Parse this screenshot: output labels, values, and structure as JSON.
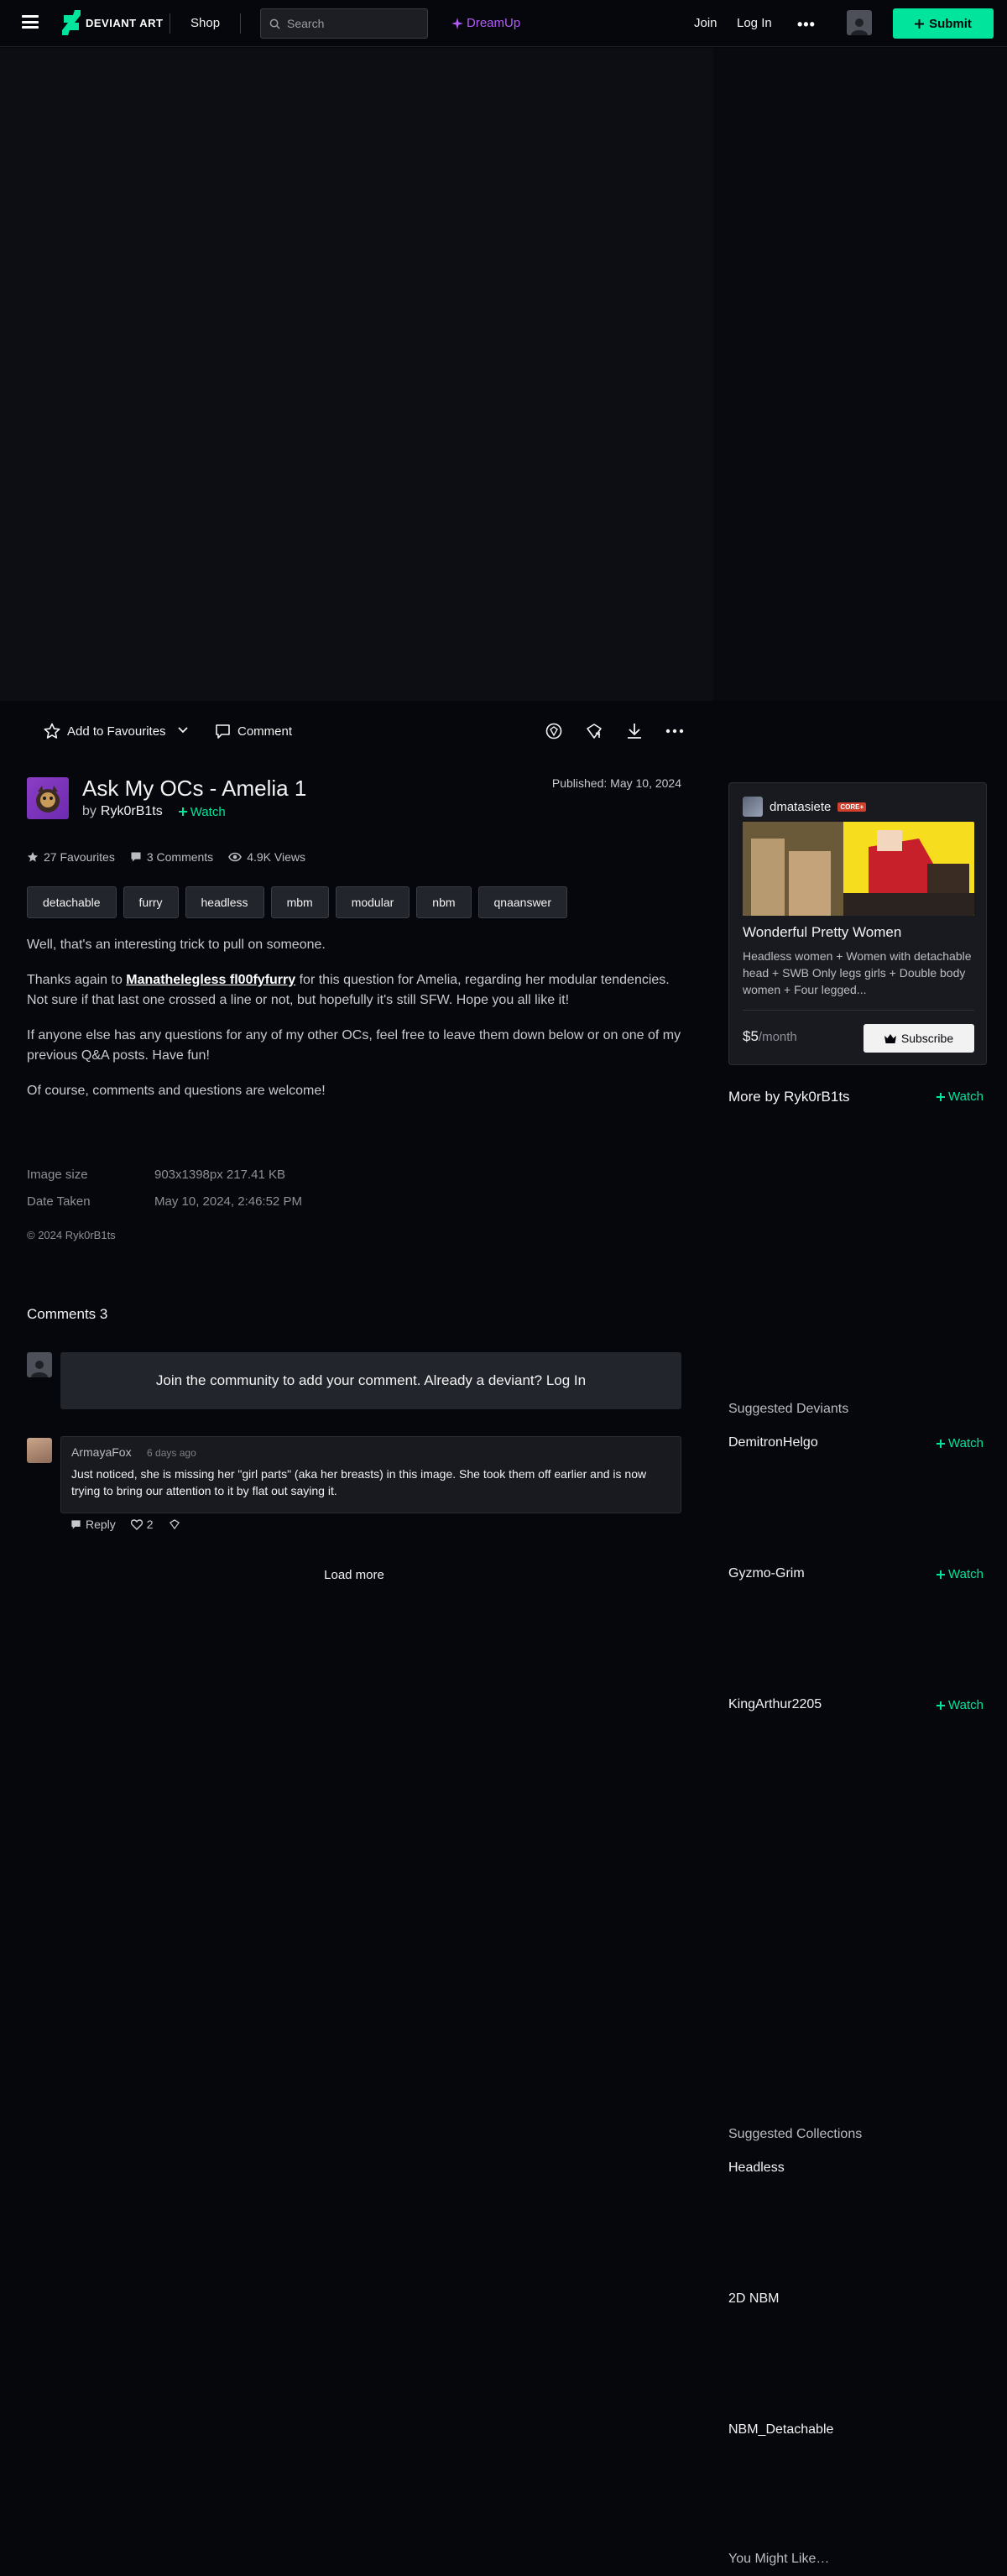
{
  "header": {
    "logo_text": "DEVIANT ART",
    "shop_label": "Shop",
    "search_placeholder": "Search",
    "dreamup_label": "DreamUp",
    "join_label": "Join",
    "login_label": "Log In",
    "more_label": "•••",
    "submit_label": "Submit"
  },
  "colors": {
    "accent_green": "#00e59b",
    "dreamup_purple": "#b25cf5",
    "background": "#06070d"
  },
  "actions": {
    "favourite_label": "Add to Favourites",
    "comment_label": "Comment",
    "icons": [
      "badge-icon",
      "gift-icon",
      "download-icon",
      "more-icon"
    ]
  },
  "deviation": {
    "title": "Ask My OCs - Amelia 1",
    "by": "by",
    "author": "Ryk0rB1ts",
    "watch_label": "Watch",
    "published": "Published: May 10, 2024",
    "favourites": "27 Favourites",
    "comments": "3 Comments",
    "views": "4.9K Views",
    "tags": [
      "detachable",
      "furry",
      "headless",
      "mbm",
      "modular",
      "nbm",
      "qnaanswer"
    ],
    "description": {
      "p1": "Well, that's an interesting trick to pull on someone.",
      "p2_before": "Thanks again to ",
      "p2_link": "Manathelegless fl00fyfurry",
      "p2_after": " for this question for Amelia, regarding her modular tendencies. Not sure if that last one crossed a line or not, but hopefully it's still SFW. Hope you all like it!",
      "p3": "If anyone else has any questions for any of my other OCs, feel free to leave them down below or on one of my previous Q&A posts. Have fun!",
      "p4": "Of course, comments and questions are welcome!"
    },
    "image_size_label": "Image size",
    "image_size_value": "903x1398px 217.41 KB",
    "date_taken_label": "Date Taken",
    "date_taken_value": "May 10, 2024, 2:46:52 PM",
    "copyright": "© 2024 Ryk0rB1ts"
  },
  "comments_section": {
    "heading": "Comments 3",
    "join_prompt": "Join the community to add your comment. Already a deviant? Log In",
    "comment": {
      "author": "ArmayaFox",
      "time": "6 days ago",
      "text": "Just noticed, she is missing her \"girl parts\" (aka her breasts) in this image. She took them off earlier and is now trying to bring our attention to it by flat out saying it.",
      "reply_label": "Reply",
      "likes": "2"
    },
    "load_more": "Load more"
  },
  "promo": {
    "user": "dmatasiete",
    "badge": "CORE+",
    "title": "Wonderful Pretty Women",
    "description": "Headless women + Women with detachable head + SWB Only legs girls + Double body women + Four legged...",
    "price": "$5",
    "per": "/month",
    "subscribe_label": "Subscribe"
  },
  "sidebar": {
    "more_by": "More by Ryk0rB1ts",
    "watch_label": "Watch",
    "suggested_deviants_heading": "Suggested Deviants",
    "suggested_deviants": [
      "DemitronHelgo",
      "Gyzmo-Grim",
      "KingArthur2205"
    ],
    "suggested_collections_heading": "Suggested Collections",
    "suggested_collections": [
      "Headless",
      "2D NBM",
      "NBM_Detachable"
    ],
    "you_might_like": "You Might Like…"
  }
}
